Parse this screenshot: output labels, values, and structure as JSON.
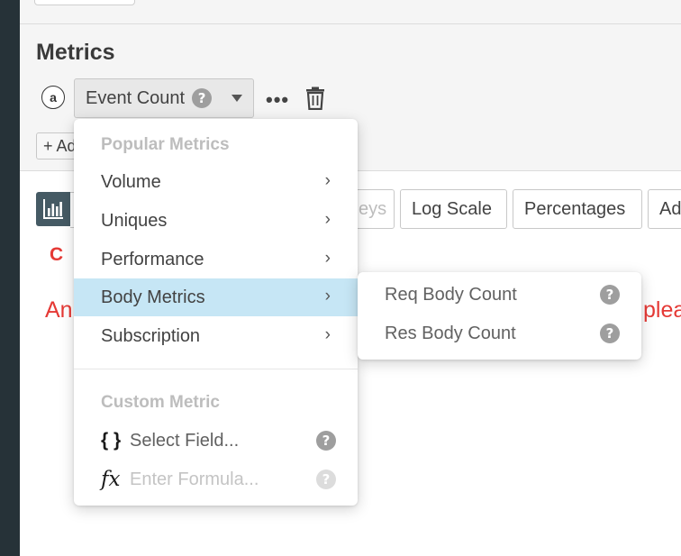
{
  "colors": {
    "rail": "#263238",
    "panel": "#f5f5f5",
    "accent_active_row": "#c6e6f5",
    "error": "#e53935",
    "chart_button": "#455a64"
  },
  "metrics": {
    "title": "Metrics",
    "series_letter": "a",
    "selected_metric": "Event Count",
    "help_glyph": "?",
    "more_glyph": "•••",
    "add_button_label": "+ Ad"
  },
  "toolbar": {
    "keys_partial": "eys",
    "log_scale": "Log Scale",
    "percentages": "Percentages",
    "advanced_partial": "Ad"
  },
  "error": {
    "icon_char": "C",
    "text_left": "An",
    "text_right": "plea"
  },
  "dropdown": {
    "popular_header": "Popular Metrics",
    "items": [
      {
        "label": "Volume",
        "chevron": "›"
      },
      {
        "label": "Uniques",
        "chevron": "›"
      },
      {
        "label": "Performance",
        "chevron": "›"
      },
      {
        "label": "Body Metrics",
        "chevron": "›"
      },
      {
        "label": "Subscription",
        "chevron": "›"
      }
    ],
    "custom_header": "Custom Metric",
    "select_field_glyph": "{ }",
    "select_field_label": "Select Field...",
    "formula_glyph": "fx",
    "formula_placeholder": "Enter Formula..."
  },
  "submenu": {
    "items": [
      {
        "label": "Req Body Count"
      },
      {
        "label": "Res Body Count"
      }
    ]
  }
}
